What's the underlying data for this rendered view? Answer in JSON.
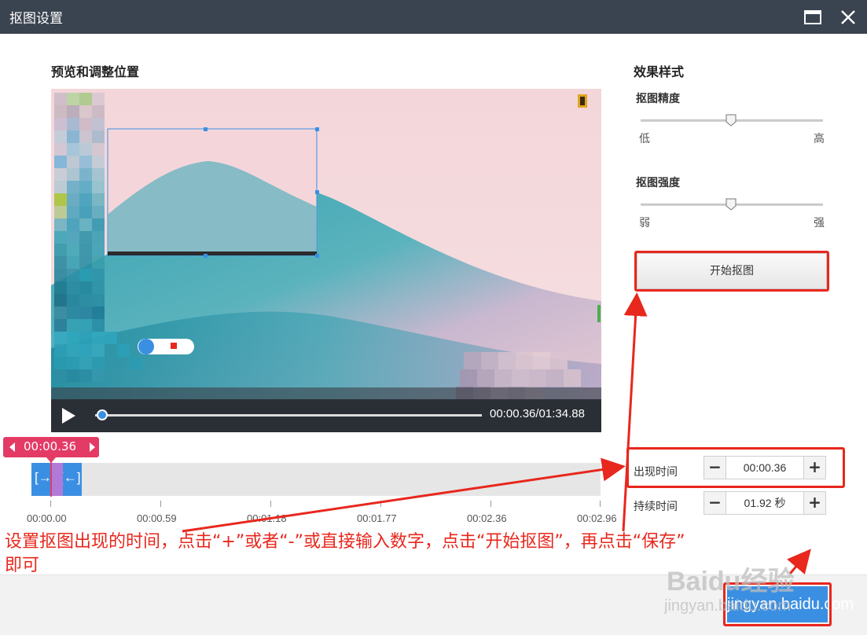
{
  "window": {
    "title": "抠图设置"
  },
  "preview": {
    "heading": "预览和调整位置",
    "time_readout": "00:00.36/01:34.88",
    "progress": 0.004
  },
  "effects": {
    "heading": "效果样式",
    "precision": {
      "label": "抠图精度",
      "low": "低",
      "high": "高",
      "value": 0.5
    },
    "strength": {
      "label": "抠图强度",
      "low": "弱",
      "high": "强",
      "value": 0.5
    },
    "start_button": "开始抠图"
  },
  "timeline": {
    "current_time": "00:00.36",
    "clip_label": "[→2(←]",
    "ticks": [
      "00:00.00",
      "00:00.59",
      "00:01.18",
      "00:01.77",
      "00:02.36",
      "00:02.96"
    ]
  },
  "appear_time": {
    "label": "出现时间",
    "value": "00:00.36",
    "minus": "−",
    "plus": "+"
  },
  "duration": {
    "label": "持续时间",
    "value": "01.92 秒",
    "minus": "−",
    "plus": "+"
  },
  "footer": {
    "save_button": "jingyan.baidu.com"
  },
  "annotation": {
    "line1": "设置抠图出现的时间，点击“+”或者“-”或直接输入数字，点击“开始抠图”，再点击“保存”",
    "line2": "即可"
  },
  "watermark": {
    "text1": "Baidu经验",
    "text2": "jingyan.baidu.com"
  },
  "colors": {
    "accent": "#3b8fe3",
    "annotation_red": "#e8271d",
    "timeline_marker": "#e43b66",
    "titlebar": "#3a4350"
  }
}
